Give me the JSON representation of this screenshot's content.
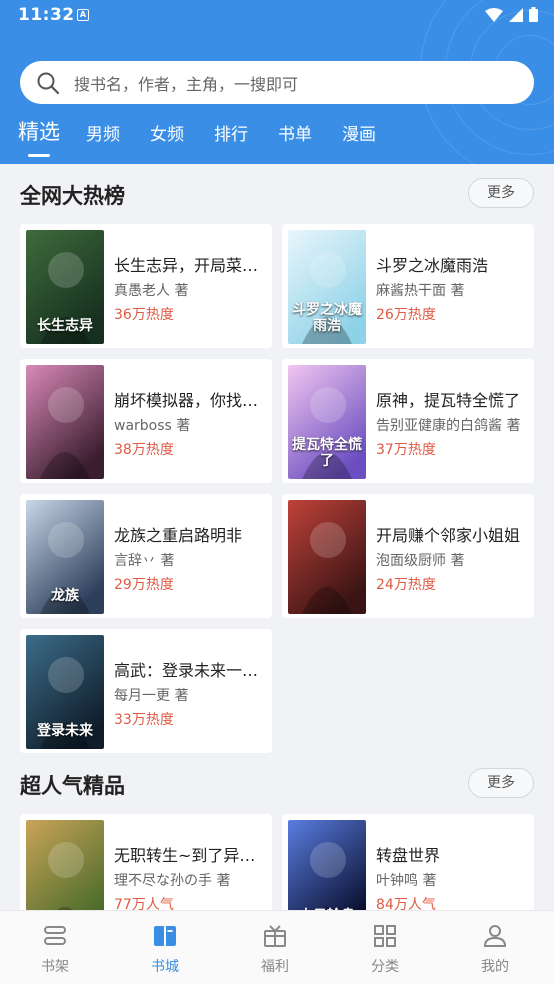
{
  "status_bar": {
    "time": "11:32"
  },
  "search": {
    "placeholder": "搜书名，作者，主角，一搜即可"
  },
  "tabs": [
    {
      "label": "精选",
      "active": true
    },
    {
      "label": "男频"
    },
    {
      "label": "女频"
    },
    {
      "label": "排行"
    },
    {
      "label": "书单"
    },
    {
      "label": "漫画"
    }
  ],
  "sections": [
    {
      "title": "全网大热榜",
      "more_label": "更多",
      "books": [
        {
          "title": "长生志异，开局菜市口被镇宫",
          "author": "真愚老人 著",
          "heat": "36万热度",
          "cover_text": "长生志异",
          "colors": [
            "#16301f",
            "#3f6b3c"
          ]
        },
        {
          "title": "斗罗之冰魔雨浩",
          "author": "麻酱热干面 著",
          "heat": "26万热度",
          "cover_text": "斗罗之冰魔雨浩",
          "colors": [
            "#8ed2e8",
            "#e9f6fb"
          ]
        },
        {
          "title": "崩坏模拟器，你找我？",
          "author": "warboss 著",
          "heat": "38万热度",
          "cover_text": "",
          "colors": [
            "#3a1d2f",
            "#d98ab8"
          ]
        },
        {
          "title": "原神，提瓦特全慌了",
          "author": "告别亚健康的白鸽酱 著",
          "heat": "37万热度",
          "cover_text": "提瓦特全慌了",
          "colors": [
            "#6b4fc0",
            "#f1c6f0"
          ]
        },
        {
          "title": "龙族之重启路明非",
          "author": "言辞丷 著",
          "heat": "29万热度",
          "cover_text": "龙族",
          "colors": [
            "#2c3e5a",
            "#c8d6e8"
          ]
        },
        {
          "title": "开局赚个邻家小姐姐",
          "author": "泡面级厨师 著",
          "heat": "24万热度",
          "cover_text": "",
          "colors": [
            "#3a1414",
            "#c0423a"
          ]
        },
        {
          "title": "高武：登录未来一万年",
          "author": "每月一更 著",
          "heat": "33万热度",
          "cover_text": "登录未来",
          "colors": [
            "#0f1d2a",
            "#3d6d8a"
          ]
        }
      ]
    },
    {
      "title": "超人气精品",
      "more_label": "更多",
      "books": [
        {
          "title": "无职转生~到了异世界就拿出真本事",
          "author": "理不尽な孙の手 著",
          "heat": "77万人气",
          "cover_text": "",
          "colors": [
            "#4a6b2a",
            "#c9a458"
          ]
        },
        {
          "title": "转盘世界",
          "author": "叶钟鸣 著",
          "heat": "84万人气",
          "cover_text": "末日轮盘",
          "colors": [
            "#0a1030",
            "#5a7de0"
          ]
        }
      ]
    }
  ],
  "bottom_nav": [
    {
      "label": "书架",
      "icon": "bookshelf-icon"
    },
    {
      "label": "书城",
      "icon": "book-open-icon",
      "active": true
    },
    {
      "label": "福利",
      "icon": "gift-icon"
    },
    {
      "label": "分类",
      "icon": "grid-icon"
    },
    {
      "label": "我的",
      "icon": "person-icon"
    }
  ],
  "colors": {
    "accent": "#3a8ee6",
    "heat": "#e05a44",
    "background": "#f1f2f5"
  }
}
